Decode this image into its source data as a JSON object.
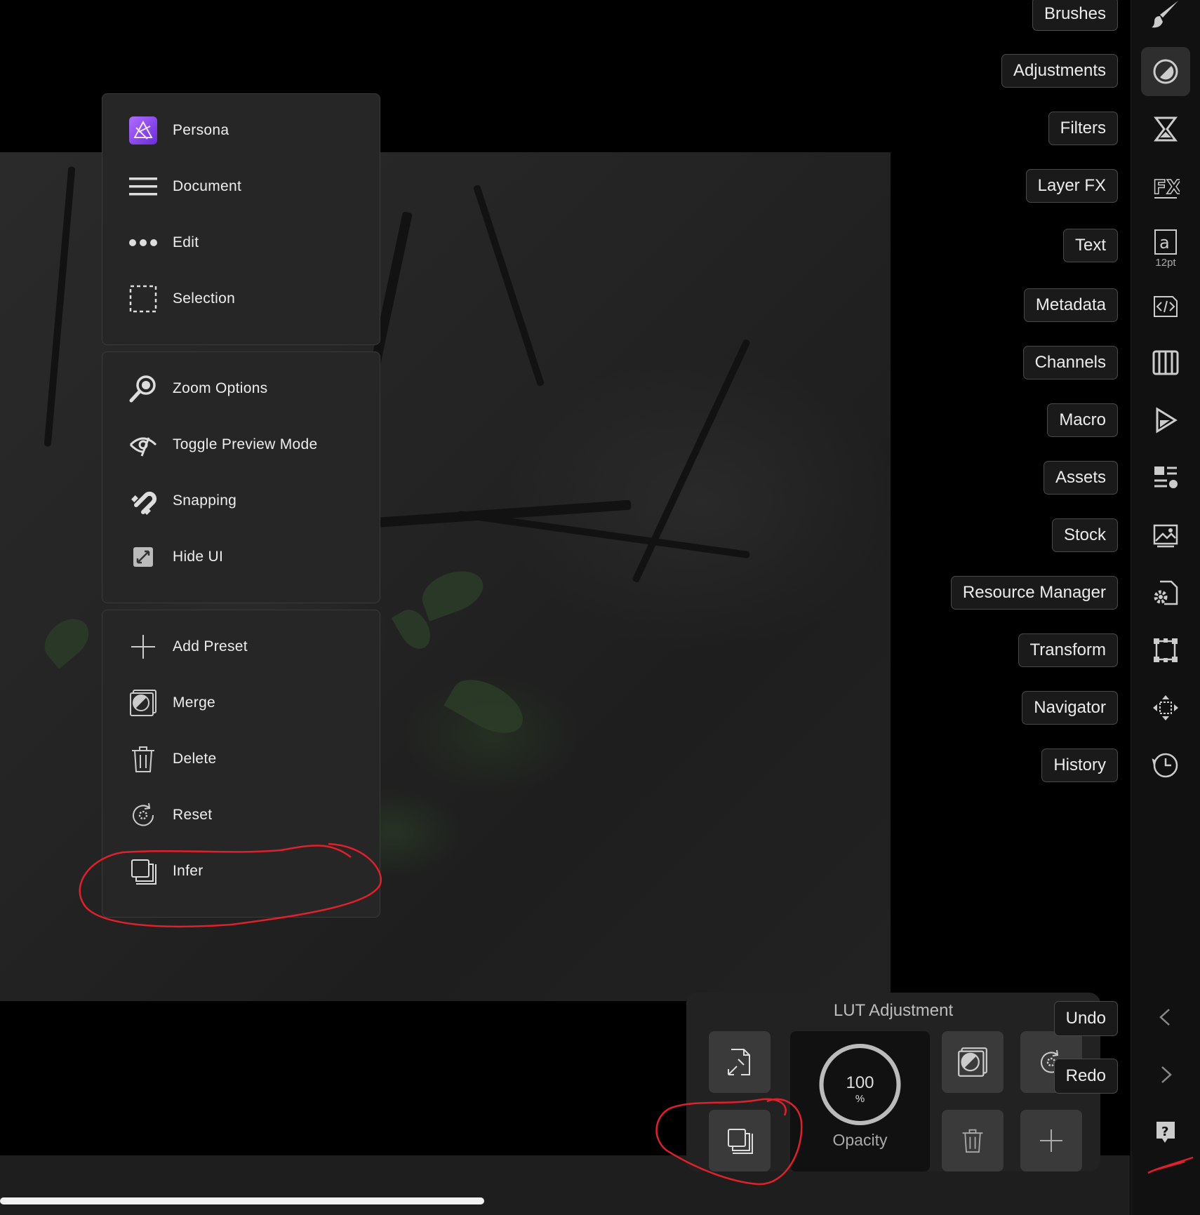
{
  "menu": {
    "group1": [
      {
        "label": "Persona",
        "icon": "affinity-photo-icon"
      },
      {
        "label": "Document",
        "icon": "hamburger-icon"
      },
      {
        "label": "Edit",
        "icon": "ellipsis-icon"
      },
      {
        "label": "Selection",
        "icon": "selection-marquee-icon"
      }
    ],
    "group2": [
      {
        "label": "Zoom Options",
        "icon": "magnifier-icon"
      },
      {
        "label": "Toggle Preview Mode",
        "icon": "preview-eye-icon"
      },
      {
        "label": "Snapping",
        "icon": "magnet-icon"
      },
      {
        "label": "Hide UI",
        "icon": "hide-ui-icon"
      }
    ],
    "group3": [
      {
        "label": "Add Preset",
        "icon": "plus-icon"
      },
      {
        "label": "Merge",
        "icon": "merge-icon"
      },
      {
        "label": "Delete",
        "icon": "trash-icon"
      },
      {
        "label": "Reset",
        "icon": "reset-icon"
      },
      {
        "label": "Infer",
        "icon": "duplicate-icon"
      }
    ]
  },
  "studio_buttons": [
    "Brushes",
    "Adjustments",
    "Filters",
    "Layer FX",
    "Text",
    "Metadata",
    "Channels",
    "Macro",
    "Assets",
    "Stock",
    "Resource Manager",
    "Transform",
    "Navigator",
    "History"
  ],
  "toolbar": {
    "text_size": "12pt",
    "icons": [
      "brush-icon",
      "adjustments-icon",
      "filters-icon",
      "fx-icon",
      "text-style-icon",
      "metadata-icon",
      "channels-icon",
      "macro-play-icon",
      "assets-icon",
      "stock-icon",
      "resource-manager-icon",
      "transform-icon",
      "navigator-icon",
      "history-icon"
    ]
  },
  "lut_panel": {
    "title": "LUT Adjustment",
    "opacity_value": "100",
    "opacity_unit": "%",
    "opacity_label": "Opacity",
    "opacity_level": 100
  },
  "history_controls": {
    "undo": "Undo",
    "redo": "Redo"
  },
  "colors": {
    "accent_purple": "#9b4dff",
    "annotation_red": "#e0202a",
    "panel_bg": "#262626"
  }
}
